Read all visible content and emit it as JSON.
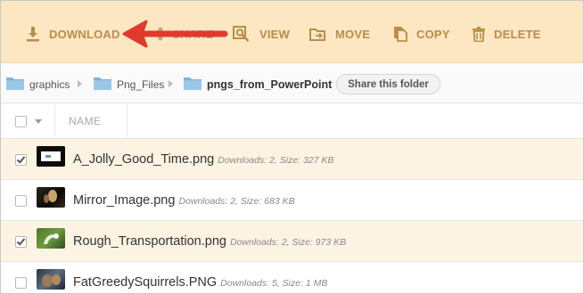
{
  "toolbar": {
    "download_label": "DOWNLOAD",
    "share_label": "SHARE",
    "view_label": "VIEW",
    "move_label": "MOVE",
    "copy_label": "COPY",
    "delete_label": "DELETE",
    "icons": [
      "download-icon",
      "share-icon",
      "view-icon",
      "move-icon",
      "copy-icon",
      "delete-icon"
    ],
    "accent": "#b98d4a",
    "background": "#fde7c2"
  },
  "annotation": {
    "arrow_color": "#e0392e"
  },
  "breadcrumb": {
    "items": [
      {
        "label": "graphics"
      },
      {
        "label": "Png_Files"
      },
      {
        "label": "pngs_from_PowerPoint"
      }
    ],
    "share_button": "Share this folder"
  },
  "table": {
    "header": {
      "name": "NAME"
    },
    "rows": [
      {
        "name": "A_Jolly_Good_Time.png",
        "meta": "Downloads: 2, Size: 327 KB",
        "checked": true
      },
      {
        "name": "Mirror_Image.png",
        "meta": "Downloads: 2, Size: 683 KB",
        "checked": false
      },
      {
        "name": "Rough_Transportation.png",
        "meta": "Downloads: 2, Size: 973 KB",
        "checked": true
      },
      {
        "name": "FatGreedySquirrels.PNG",
        "meta": "Downloads: 5, Size: 1 MB",
        "checked": false
      }
    ]
  }
}
